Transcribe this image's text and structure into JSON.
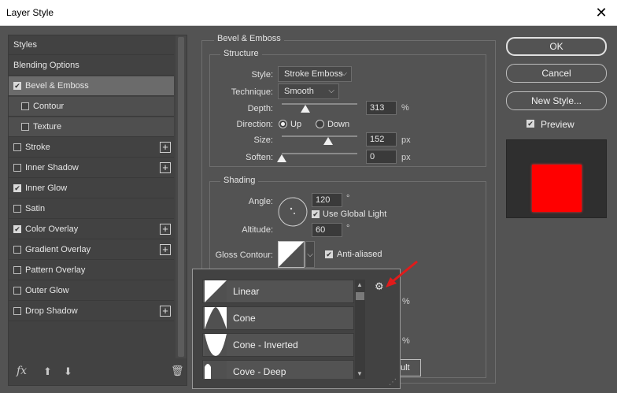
{
  "window": {
    "title": "Layer Style",
    "close_glyph": "✕"
  },
  "style_list": {
    "items": [
      {
        "label": "Styles",
        "checkbox": false,
        "checked": false,
        "plus": false,
        "selected": false,
        "sub": false
      },
      {
        "label": "Blending Options",
        "checkbox": false,
        "checked": false,
        "plus": false,
        "selected": false,
        "sub": false
      },
      {
        "label": "Bevel & Emboss",
        "checkbox": true,
        "checked": true,
        "plus": false,
        "selected": true,
        "sub": false
      },
      {
        "label": "Contour",
        "checkbox": true,
        "checked": false,
        "plus": false,
        "selected": false,
        "sub": true
      },
      {
        "label": "Texture",
        "checkbox": true,
        "checked": false,
        "plus": false,
        "selected": false,
        "sub": true
      },
      {
        "label": "Stroke",
        "checkbox": true,
        "checked": false,
        "plus": true,
        "selected": false,
        "sub": false
      },
      {
        "label": "Inner Shadow",
        "checkbox": true,
        "checked": false,
        "plus": true,
        "selected": false,
        "sub": false
      },
      {
        "label": "Inner Glow",
        "checkbox": true,
        "checked": true,
        "plus": false,
        "selected": false,
        "sub": false
      },
      {
        "label": "Satin",
        "checkbox": true,
        "checked": false,
        "plus": false,
        "selected": false,
        "sub": false
      },
      {
        "label": "Color Overlay",
        "checkbox": true,
        "checked": true,
        "plus": true,
        "selected": false,
        "sub": false
      },
      {
        "label": "Gradient Overlay",
        "checkbox": true,
        "checked": false,
        "plus": true,
        "selected": false,
        "sub": false
      },
      {
        "label": "Pattern Overlay",
        "checkbox": true,
        "checked": false,
        "plus": false,
        "selected": false,
        "sub": false
      },
      {
        "label": "Outer Glow",
        "checkbox": true,
        "checked": false,
        "plus": false,
        "selected": false,
        "sub": false
      },
      {
        "label": "Drop Shadow",
        "checkbox": true,
        "checked": false,
        "plus": true,
        "selected": false,
        "sub": false
      }
    ],
    "footer": {
      "fx": "fx",
      "up": "⬆",
      "down": "⬇",
      "trash": "🗑"
    }
  },
  "bevel": {
    "group_title": "Bevel & Emboss",
    "structure": {
      "title": "Structure",
      "style_label": "Style:",
      "style_value": "Stroke Emboss",
      "technique_label": "Technique:",
      "technique_value": "Smooth",
      "depth_label": "Depth:",
      "depth_value": "313",
      "depth_unit": "%",
      "depth_fraction": 0.31,
      "direction_label": "Direction:",
      "direction_up": "Up",
      "direction_down": "Down",
      "size_label": "Size:",
      "size_value": "152",
      "size_unit": "px",
      "size_fraction": 0.61,
      "soften_label": "Soften:",
      "soften_value": "0",
      "soften_unit": "px",
      "soften_fraction": 0
    },
    "shading": {
      "title": "Shading",
      "angle_label": "Angle:",
      "angle_value": "120",
      "angle_unit": "°",
      "global_light_label": "Use Global Light",
      "altitude_label": "Altitude:",
      "altitude_value": "60",
      "altitude_unit": "°",
      "gloss_label": "Gloss Contour:",
      "anti_aliased_label": "Anti-aliased",
      "hidden_pct_1": "%",
      "hidden_pct_2": "%",
      "partial_button": "ult"
    }
  },
  "buttons": {
    "ok": "OK",
    "cancel": "Cancel",
    "new_style": "New Style...",
    "preview": "Preview"
  },
  "preview": {
    "swatch_color": "#ff0000"
  },
  "contour_popup": {
    "items": [
      {
        "name": "Linear",
        "icon": "linear-contour-icon"
      },
      {
        "name": "Cone",
        "icon": "cone-contour-icon"
      },
      {
        "name": "Cone - Inverted",
        "icon": "cone-inverted-contour-icon"
      },
      {
        "name": "Cove - Deep",
        "icon": "cove-deep-contour-icon"
      }
    ],
    "gear_glyph": "⚙"
  },
  "colors": {
    "accent_arrow": "#e01b1b",
    "panel_bg": "#535353",
    "list_bg": "#424242"
  }
}
